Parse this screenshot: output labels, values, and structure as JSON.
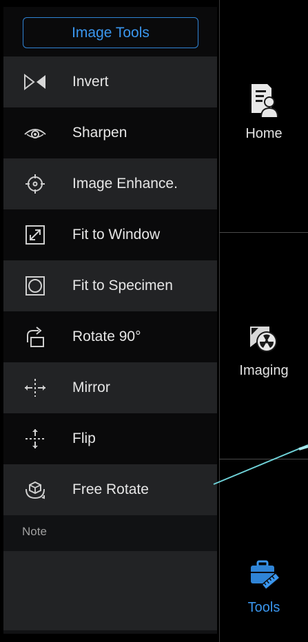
{
  "panel": {
    "header_button": "Image Tools",
    "tools": [
      {
        "label": "Invert",
        "icon": "invert-icon"
      },
      {
        "label": "Sharpen",
        "icon": "eye-icon"
      },
      {
        "label": "Image Enhance.",
        "icon": "crosshair-icon"
      },
      {
        "label": "Fit to Window",
        "icon": "expand-arrows-icon"
      },
      {
        "label": "Fit to Specimen",
        "icon": "fit-specimen-icon"
      },
      {
        "label": "Rotate 90°",
        "icon": "rotate-90-icon"
      },
      {
        "label": "Mirror",
        "icon": "mirror-icon"
      },
      {
        "label": "Flip",
        "icon": "flip-icon"
      },
      {
        "label": "Free Rotate",
        "icon": "free-rotate-icon"
      }
    ],
    "note_label": "Note",
    "note_value": ""
  },
  "nav": {
    "items": [
      {
        "label": "Home",
        "icon": "patient-record-icon"
      },
      {
        "label": "Imaging",
        "icon": "radiation-imaging-icon"
      },
      {
        "label": "Tools",
        "icon": "toolbox-icon",
        "active": true
      }
    ]
  },
  "colors": {
    "accent": "#3a96ee",
    "panel_bg": "#111214",
    "row_light": "#222325",
    "row_dark": "#0a0a0b",
    "pointer_line": "#6fd2d8"
  }
}
